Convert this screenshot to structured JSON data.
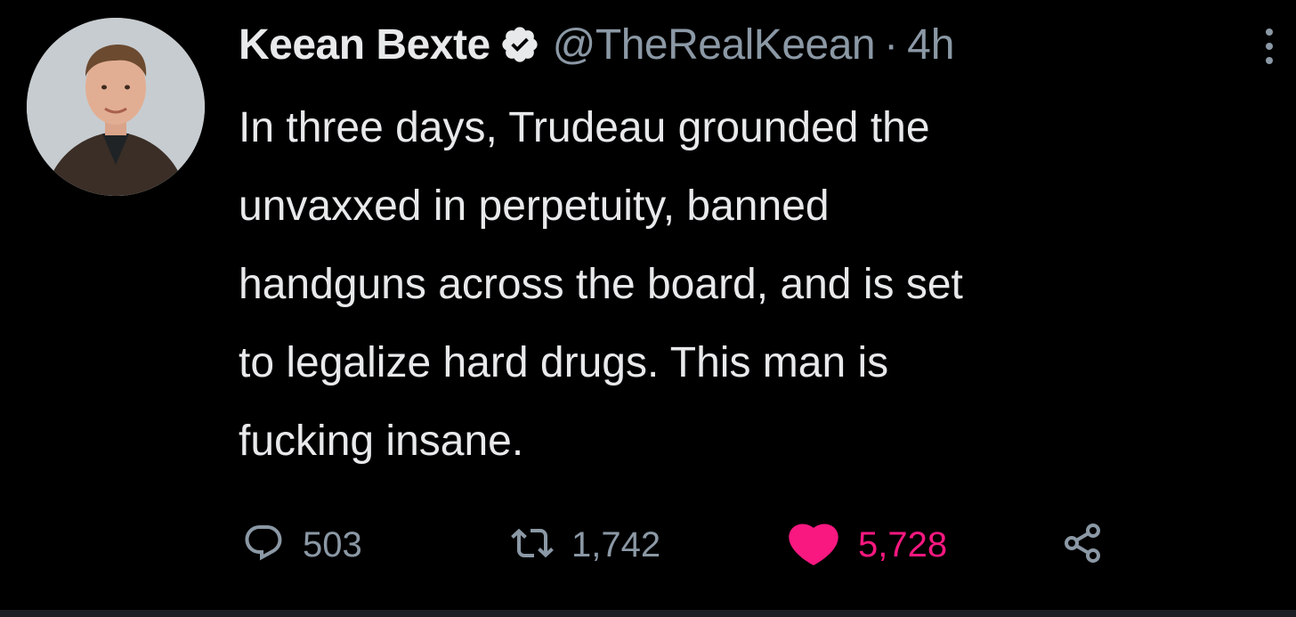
{
  "author": {
    "display_name": "Keean Bexte",
    "handle": "@TheRealKeean",
    "time_separator": "·",
    "time": "4h",
    "verified_icon": "verified-badge-icon",
    "avatar_icon": "profile-photo"
  },
  "tweet": {
    "lines": [
      "In three days, Trudeau grounded the",
      "unvaxxed in perpetuity, banned",
      "handguns across the board, and is set",
      "to legalize hard drugs. This man is",
      "fucking insane."
    ]
  },
  "actions": {
    "reply": {
      "icon": "reply-icon",
      "count": "503"
    },
    "retweet": {
      "icon": "retweet-icon",
      "count": "1,742"
    },
    "like": {
      "icon": "heart-icon",
      "count": "5,728",
      "color": "#f91880"
    },
    "share": {
      "icon": "share-icon"
    }
  },
  "more_icon": "more-options-icon",
  "colors": {
    "background": "#000000",
    "text": "#e7e9ea",
    "muted": "#8b98a5",
    "like": "#f91880"
  }
}
